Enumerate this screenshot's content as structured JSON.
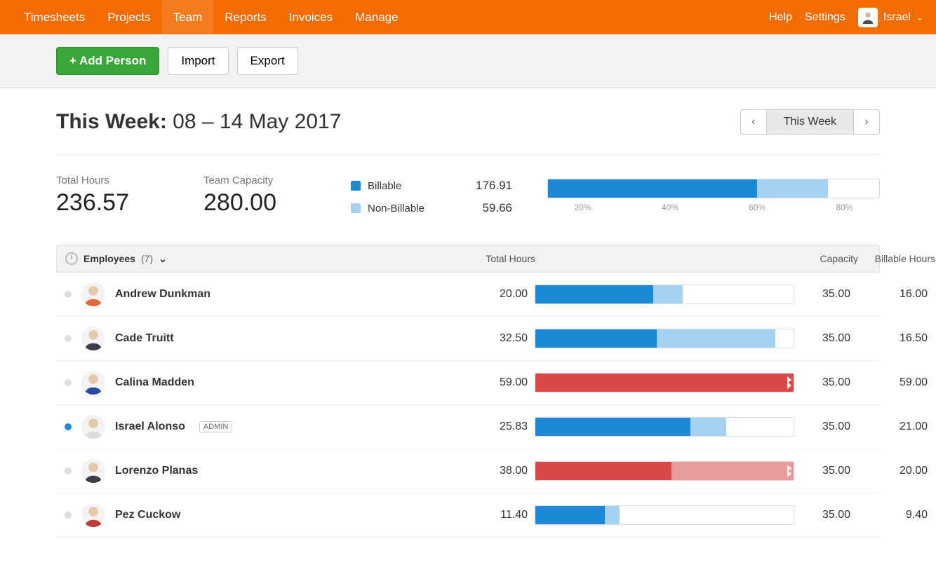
{
  "nav": {
    "items": [
      "Timesheets",
      "Projects",
      "Team",
      "Reports",
      "Invoices",
      "Manage"
    ],
    "active_index": 2,
    "help": "Help",
    "settings": "Settings",
    "user_name": "Israel"
  },
  "toolbar": {
    "add_person": "Add Person",
    "import": "Import",
    "export": "Export"
  },
  "week": {
    "title_prefix": "This Week:",
    "range": "08 – 14 May 2017",
    "period_label": "This Week"
  },
  "summary": {
    "total_label": "Total Hours",
    "total_value": "236.57",
    "capacity_label": "Team Capacity",
    "capacity_value": "280.00",
    "billable_label": "Billable",
    "billable_value": "176.91",
    "nonbillable_label": "Non-Billable",
    "nonbillable_value": "59.66",
    "ticks": [
      "20%",
      "40%",
      "60%",
      "80%"
    ]
  },
  "table": {
    "header_employees": "Employees",
    "employee_count": "(7)",
    "header_total": "Total Hours",
    "header_capacity": "Capacity",
    "header_billable": "Billable Hours",
    "rows": [
      {
        "name": "Andrew Dunkman",
        "total": "20.00",
        "capacity": "35.00",
        "billable": "16.00",
        "billable_h": 16.0,
        "nonbillable_h": 4.0,
        "over": false,
        "active": false,
        "admin": false,
        "shirt": "#e06a3a"
      },
      {
        "name": "Cade Truitt",
        "total": "32.50",
        "capacity": "35.00",
        "billable": "16.50",
        "billable_h": 16.5,
        "nonbillable_h": 16.0,
        "over": false,
        "active": false,
        "admin": false,
        "shirt": "#3b3f4a"
      },
      {
        "name": "Calina Madden",
        "total": "59.00",
        "capacity": "35.00",
        "billable": "59.00",
        "billable_h": 59.0,
        "nonbillable_h": 0.0,
        "over": true,
        "active": false,
        "admin": false,
        "shirt": "#2a4aa0"
      },
      {
        "name": "Israel Alonso",
        "total": "25.83",
        "capacity": "35.00",
        "billable": "21.00",
        "billable_h": 21.0,
        "nonbillable_h": 4.83,
        "over": false,
        "active": true,
        "admin": true,
        "shirt": "#dcdcdc"
      },
      {
        "name": "Lorenzo Planas",
        "total": "38.00",
        "capacity": "35.00",
        "billable": "20.00",
        "billable_h": 20.0,
        "nonbillable_h": 18.0,
        "over": true,
        "active": false,
        "admin": false,
        "shirt": "#3b3f4a"
      },
      {
        "name": "Pez Cuckow",
        "total": "11.40",
        "capacity": "35.00",
        "billable": "9.40",
        "billable_h": 9.4,
        "nonbillable_h": 2.0,
        "over": false,
        "active": false,
        "admin": false,
        "shirt": "#c03a3a"
      }
    ],
    "admin_badge": "ADMIN"
  },
  "chart_data": {
    "type": "bar",
    "title": "Team hours vs capacity",
    "summary": {
      "billable_hours": 176.91,
      "nonbillable_hours": 59.66,
      "team_capacity": 280.0,
      "billable_pct_of_capacity": 63.2,
      "nonbillable_pct_of_capacity": 21.3
    },
    "categories": [
      "Andrew Dunkman",
      "Cade Truitt",
      "Calina Madden",
      "Israel Alonso",
      "Lorenzo Planas",
      "Pez Cuckow"
    ],
    "series": [
      {
        "name": "Billable Hours",
        "values": [
          16.0,
          16.5,
          59.0,
          21.0,
          20.0,
          9.4
        ]
      },
      {
        "name": "Non-Billable Hours",
        "values": [
          4.0,
          16.0,
          0.0,
          4.83,
          18.0,
          2.0
        ]
      },
      {
        "name": "Capacity",
        "values": [
          35.0,
          35.0,
          35.0,
          35.0,
          35.0,
          35.0
        ]
      }
    ],
    "xlabel": "Hours",
    "ylabel": "",
    "xlim": [
      0,
      35
    ]
  }
}
